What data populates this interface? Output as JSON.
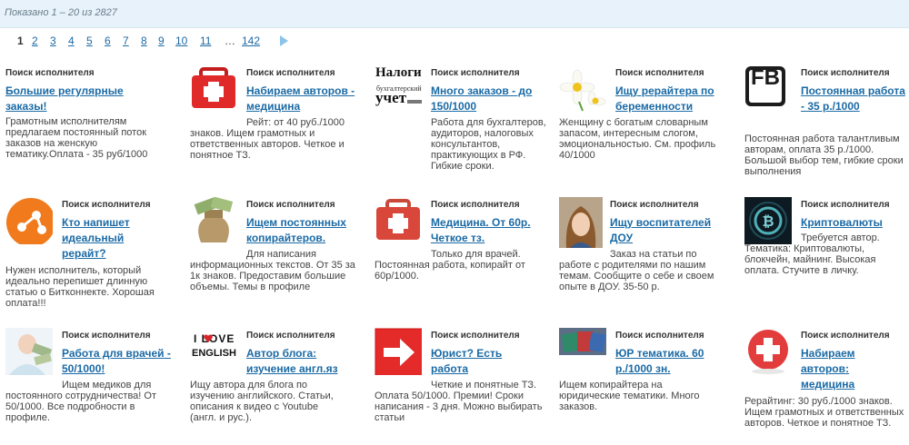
{
  "summary": "Показано 1 – 20 из 2827",
  "pagination": {
    "pages": [
      "1",
      "2",
      "3",
      "4",
      "5",
      "6",
      "7",
      "8",
      "9",
      "10",
      "11"
    ],
    "current": "1",
    "ellipsis": "…",
    "last": "142"
  },
  "cards": [
    {
      "label": "Поиск исполнителя",
      "title": "Большие регулярные заказы!",
      "body": "Грамотным исполнителям предлагаем постоянный поток заказов на женскую тематику.Оплата - 35 руб/1000",
      "icon": "none"
    },
    {
      "label": "Поиск исполнителя",
      "title": "Набираем авторов - медицина",
      "body": "Рейт: от 40 руб./1000 знаков. Ищем грамотных и ответственных авторов. Четкое и понятное ТЗ.",
      "icon": "medical-kit-icon"
    },
    {
      "label": "Поиск исполнителя",
      "title": "Много заказов - до 150/1000",
      "body": "Работа для бухгалтеров, аудиторов, налоговых консультантов, практикующих в РФ. Гибкие сроки.",
      "icon": "taxes-accounting-logo",
      "logo_lines": [
        "Налоги",
        "бухгалтерский",
        "учет"
      ]
    },
    {
      "label": "Поиск исполнителя",
      "title": "Ищу рерайтера по беременности",
      "body": "Женщину с богатым словарным запасом, интересным слогом, эмоциональностью. См. профиль 40/1000",
      "icon": "daisy-flowers-icon"
    },
    {
      "label": "Поиск исполнителя",
      "title": "Постоянная работа - 35 р./1000",
      "body": "Постоянная работа талантливым авторам, оплата 35 р./1000. Большой выбор тем, гибкие сроки выполнения",
      "icon": "fb-logo-icon",
      "logo_text": "FB"
    },
    {
      "label": "Поиск исполнителя",
      "title": "Кто напишет идеальный рерайт?",
      "body": "Нужен исполнитель, который идеально перепишет длинную статью о Битконнекте. Хорошая оплата!!!",
      "icon": "orange-share-icon"
    },
    {
      "label": "Поиск исполнителя",
      "title": "Ищем постоянных копирайтеров.",
      "body": "Для написания информационных текстов. От 35 за 1к знаков. Предоставим большие объемы. Темы в профиле",
      "icon": "money-bag-icon"
    },
    {
      "label": "Поиск исполнителя",
      "title": "Медицина. От 60р. Четкое тз.",
      "body": "Только для врачей. Постоянная работа, копирайт от 60р/1000.",
      "icon": "medical-kit-icon"
    },
    {
      "label": "Поиск исполнителя",
      "title": "Ищу воспитателей ДОУ",
      "body": "Заказ на статьи по работе с родителями по нашим темам. Сообщите о себе и своем опыте в ДОУ. 35-50 р.",
      "icon": "avatar-photo"
    },
    {
      "label": "Поиск исполнителя",
      "title": "Криптовалюты",
      "body": "Требуется автор. Тематика: Криптовалюты, блокчейн, майнинг. Высокая оплата. Стучите в личку.",
      "icon": "bitcoin-icon"
    },
    {
      "label": "Поиск исполнителя",
      "title": "Работа для врачей - 50/1000!",
      "body": "Ищем медиков для постоянного сотрудничества! От 50/1000. Все подробности в профиле.",
      "icon": "doctor-money-icon"
    },
    {
      "label": "Поиск исполнителя",
      "title": "Автор блога: изучение англ.яз",
      "body": "Ищу автора для блога по изучению английского. Статьи, описания к видео с Youtube (англ. и рус.).",
      "icon": "love-english-logo",
      "logo_lines": [
        "I LOVE",
        "ENGLISH"
      ]
    },
    {
      "label": "Поиск исполнителя",
      "title": "Юрист? Есть работа",
      "body": "Четкие и понятные ТЗ. Оплата 50/1000. Премии! Сроки написания - 3 дня. Можно выбирать статьи",
      "icon": "arrow-right-icon"
    },
    {
      "label": "Поиск исполнителя",
      "title": "ЮР тематика. 60 р./1000 зн.",
      "body": "Ищем копирайтера на юридические тематики. Много заказов.",
      "icon": "documents-icon"
    },
    {
      "label": "Поиск исполнителя",
      "title": "Набираем авторов: медицина",
      "body": "Рерайтинг: 30 руб./1000 знаков. Ищем грамотных и ответственных авторов. Четкое и понятное ТЗ.",
      "icon": "medical-cross-icon"
    }
  ],
  "colors": {
    "link": "#1a6aa5",
    "topbar": "#e7f2fa",
    "medical_red": "#e02a2a",
    "orange": "#f07a1c"
  }
}
